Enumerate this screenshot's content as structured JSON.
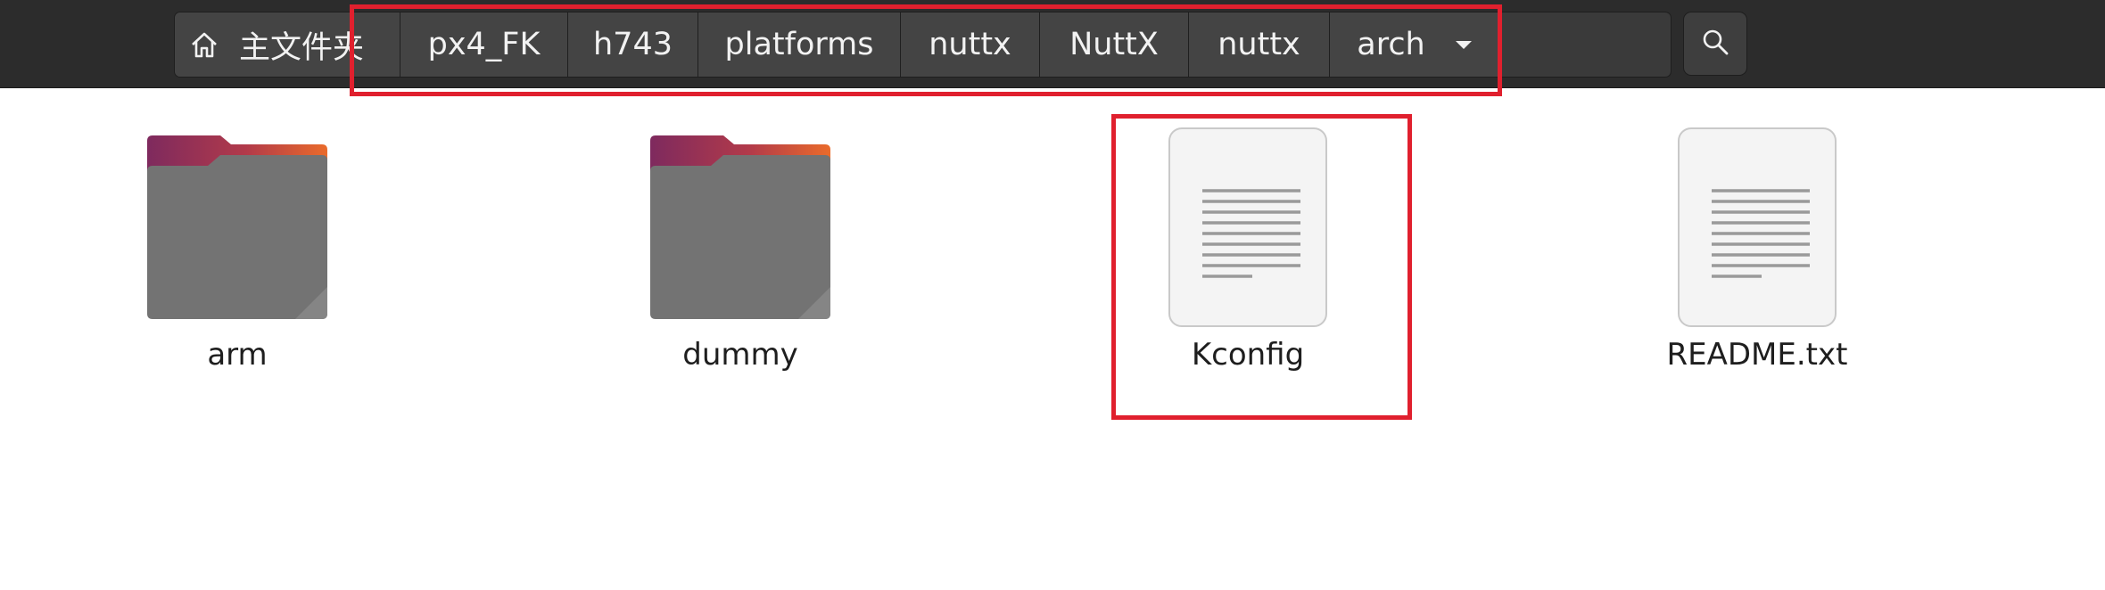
{
  "pathbar": {
    "crumbs": [
      {
        "label": "主文件夹"
      },
      {
        "label": "px4_FK"
      },
      {
        "label": "h743"
      },
      {
        "label": "platforms"
      },
      {
        "label": "nuttx"
      },
      {
        "label": "NuttX"
      },
      {
        "label": "nuttx"
      },
      {
        "label": "arch"
      }
    ]
  },
  "icons": {
    "home": "home-icon",
    "search": "search-icon",
    "dropdown": "chevron-down-icon",
    "folder": "folder-icon",
    "document": "text-document-icon"
  },
  "files": [
    {
      "name": "arm",
      "type": "folder"
    },
    {
      "name": "dummy",
      "type": "folder"
    },
    {
      "name": "Kconfig",
      "type": "document"
    },
    {
      "name": "README.txt",
      "type": "document"
    }
  ],
  "colors": {
    "header_bg": "#2c2c2c",
    "highlight": "#e0202e",
    "folder_body": "#737373",
    "folder_tab_start": "#8a2a5c",
    "folder_tab_end": "#e8602c"
  }
}
